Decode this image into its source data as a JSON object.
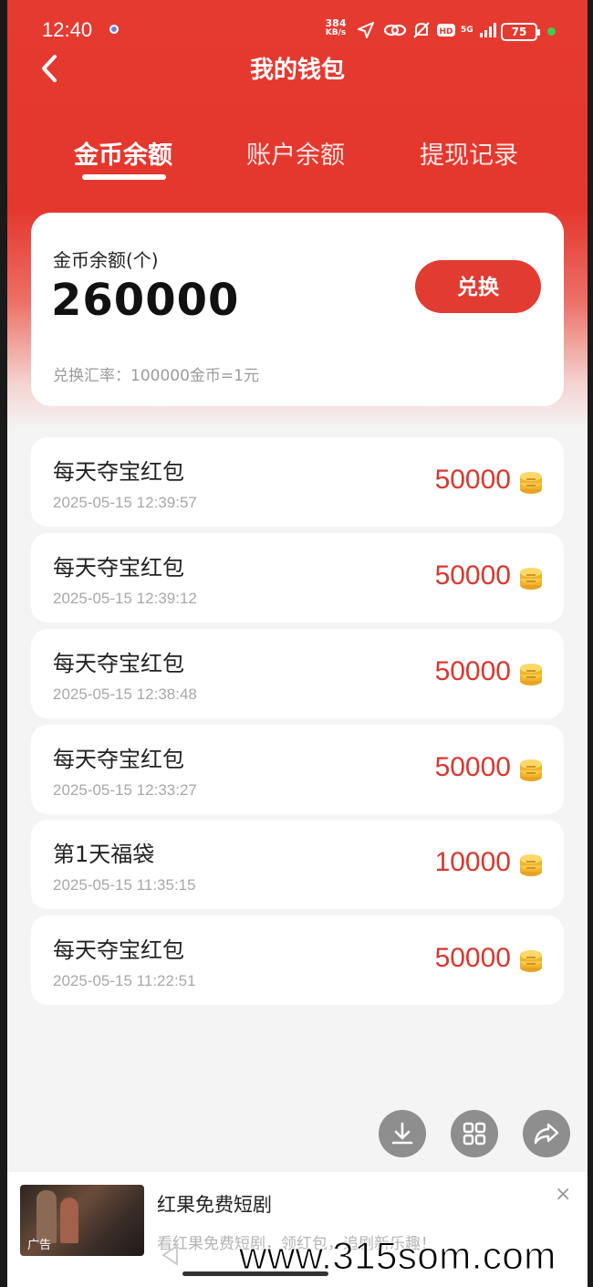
{
  "status_bar": {
    "time": "12:40",
    "net_speed_value": "384",
    "net_speed_unit": "KB/s",
    "network_label": "5G",
    "battery": "75"
  },
  "header": {
    "title": "我的钱包"
  },
  "tabs": [
    {
      "label": "金币余额",
      "active": true
    },
    {
      "label": "账户余额",
      "active": false
    },
    {
      "label": "提现记录",
      "active": false
    }
  ],
  "balance": {
    "label": "金币余额(个)",
    "value": "260000",
    "button_label": "兑换",
    "rate_text": "兑换汇率：100000金币=1元"
  },
  "records": [
    {
      "title": "每天夺宝红包",
      "time": "2025-05-15 12:39:57",
      "amount": "50000"
    },
    {
      "title": "每天夺宝红包",
      "time": "2025-05-15 12:39:12",
      "amount": "50000"
    },
    {
      "title": "每天夺宝红包",
      "time": "2025-05-15 12:38:48",
      "amount": "50000"
    },
    {
      "title": "每天夺宝红包",
      "time": "2025-05-15 12:33:27",
      "amount": "50000"
    },
    {
      "title": "第1天福袋",
      "time": "2025-05-15 11:35:15",
      "amount": "10000"
    },
    {
      "title": "每天夺宝红包",
      "time": "2025-05-15 11:22:51",
      "amount": "50000"
    }
  ],
  "floating_actions": [
    "download-icon",
    "grid-icon",
    "share-icon"
  ],
  "ad": {
    "tag": "广告",
    "title": "红果免费短剧",
    "description": "看红果免费短剧，领红包，追剧新乐趣！",
    "close": "×"
  },
  "watermark": "www.315som.com",
  "colors": {
    "primary_red": "#e23b32",
    "amount_red": "#d8382f",
    "coin_gold": "#f0b429"
  }
}
